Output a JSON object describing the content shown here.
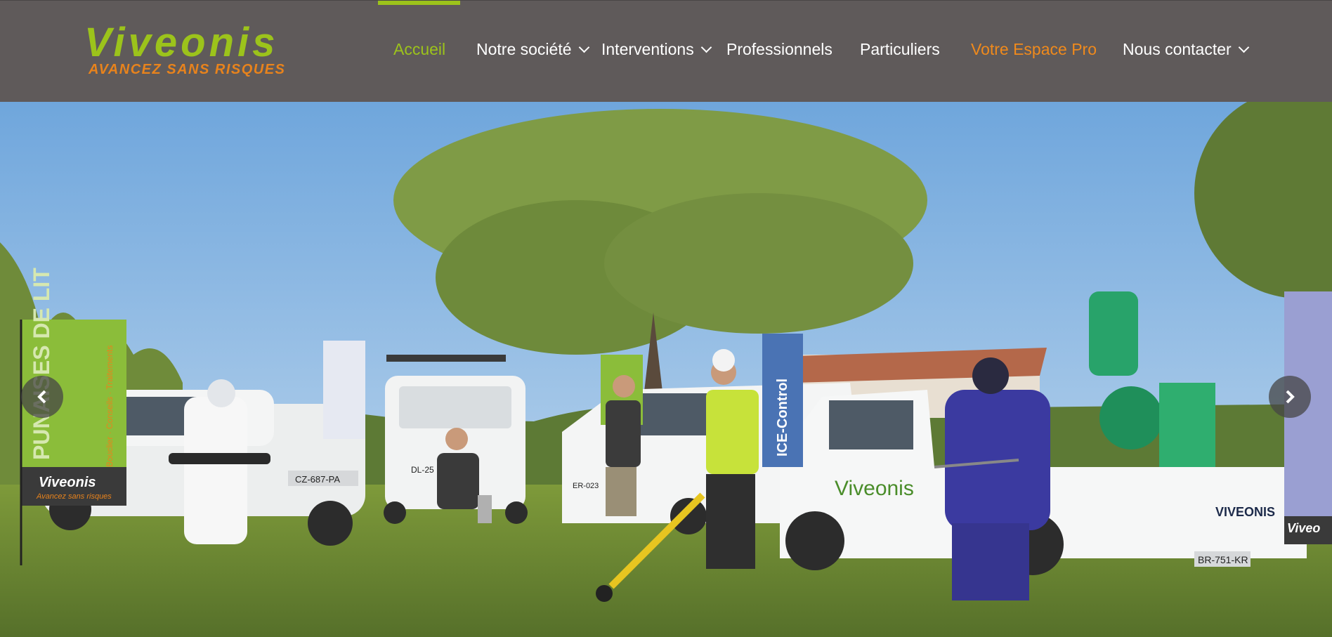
{
  "brand": {
    "name": "Viveonis",
    "tagline": "AVANCEZ SANS RISQUES",
    "colors": {
      "green": "#9cc31b",
      "orange": "#f08a1c",
      "header_bg": "#5f5a5a"
    }
  },
  "nav": {
    "items": [
      {
        "label": "Accueil",
        "active": true,
        "dropdown": false
      },
      {
        "label": "Notre société",
        "dropdown": true
      },
      {
        "label": "Interventions",
        "dropdown": true
      },
      {
        "label": "Professionnels",
        "dropdown": false
      },
      {
        "label": "Particuliers",
        "dropdown": false
      },
      {
        "label": "Votre Espace Pro",
        "highlight": true,
        "dropdown": false
      },
      {
        "label": "Nous contacter",
        "dropdown": true
      }
    ]
  },
  "hero": {
    "flag_left_main": "PUNAISES DE LIT",
    "flag_left_sub": "Bouclier · Conseils · Traitements",
    "flag_left_brand": "Viveonis",
    "flag_left_brand_sub": "Avancez sans risques",
    "flag_center_blue": "ICE-Control",
    "truck_logo": "Viveonis",
    "truck_rear_logo": "VIVEONIS",
    "plate_car_left": "CZ-687-PA",
    "plate_van": "DL-25",
    "plate_berlingo": "ER-023",
    "plate_truck": "BR-751-KR",
    "flag_right_brand": "Viveo",
    "arrow_prev_icon": "chevron-left-icon",
    "arrow_next_icon": "chevron-right-icon"
  }
}
